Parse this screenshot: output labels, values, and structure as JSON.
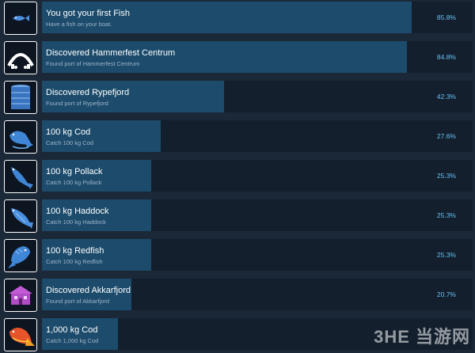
{
  "achievements": [
    {
      "title": "You got your first Fish",
      "description": "Have a fish on your boat.",
      "percent": "85.8%",
      "fill": 0.858,
      "icon": "small-fish-icon"
    },
    {
      "title": "Discovered Hammerfest Centrum",
      "description": "Found port of Hammerfest Centrum",
      "percent": "84.8%",
      "fill": 0.848,
      "icon": "harbor-arch-icon"
    },
    {
      "title": "Discovered Rypefjord",
      "description": "Found port of Rypefjord",
      "percent": "42.3%",
      "fill": 0.423,
      "icon": "storage-silo-icon"
    },
    {
      "title": "100 kg Cod",
      "description": "Catch 100 kg Cod",
      "percent": "27.6%",
      "fill": 0.276,
      "icon": "cod-fish-icon"
    },
    {
      "title": "100 kg Pollack",
      "description": "Catch 100 kg Pollack",
      "percent": "25.3%",
      "fill": 0.253,
      "icon": "pollack-fish-icon"
    },
    {
      "title": "100 kg Haddock",
      "description": "Catch 100 kg Haddock",
      "percent": "25.3%",
      "fill": 0.253,
      "icon": "haddock-fish-icon"
    },
    {
      "title": "100 kg Redfish",
      "description": "Catch 100 kg Redfish",
      "percent": "25.3%",
      "fill": 0.253,
      "icon": "redfish-icon"
    },
    {
      "title": "Discovered Akkarfjord",
      "description": "Found port of Akkarfjord",
      "percent": "20.7%",
      "fill": 0.207,
      "icon": "house-icon"
    },
    {
      "title": "1,000 kg Cod",
      "description": "Catch 1,000 kg Cod",
      "percent": "",
      "fill": 0.176,
      "icon": "golden-cod-icon"
    }
  ],
  "watermark": "3HE 当游网",
  "colors": {
    "background": "#1b2838",
    "bar_fill": "#1c4b6b",
    "bar_track": "#131f2d",
    "percent": "#66c0f4",
    "icon_blue": "#3a7fd0",
    "icon_purple": "#c25bd6",
    "icon_orange": "#e8542a"
  }
}
